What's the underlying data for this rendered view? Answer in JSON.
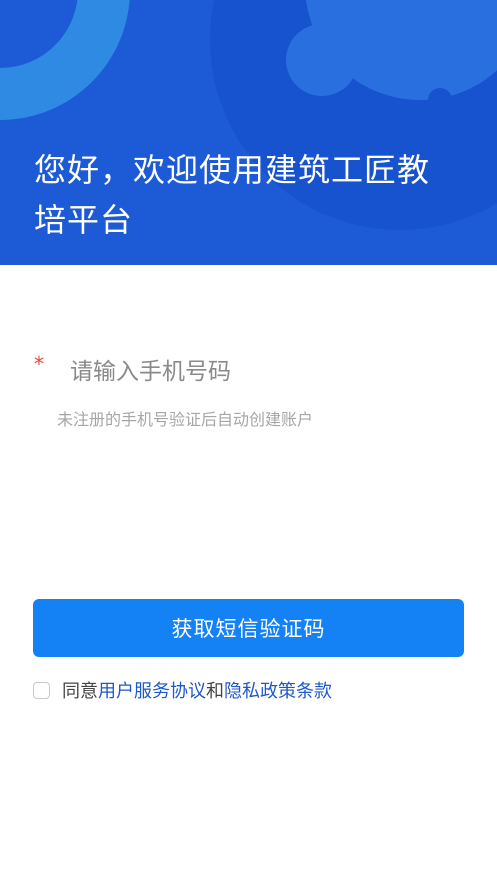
{
  "header": {
    "welcome_text": "您好，欢迎使用建筑工匠教培平台",
    "bg_color": "#1c5ad6"
  },
  "form": {
    "required_mark": "*",
    "phone_placeholder": "请输入手机号码",
    "phone_value": "",
    "hint": "未注册的手机号验证后自动创建账户"
  },
  "actions": {
    "get_code_label": "获取短信验证码",
    "button_color": "#1482f5"
  },
  "agreement": {
    "checked": false,
    "prefix": "同意",
    "user_agreement": "用户服务协议",
    "conjunction": "和",
    "privacy_policy": "隐私政策条款",
    "link_color": "#1f59c7"
  }
}
